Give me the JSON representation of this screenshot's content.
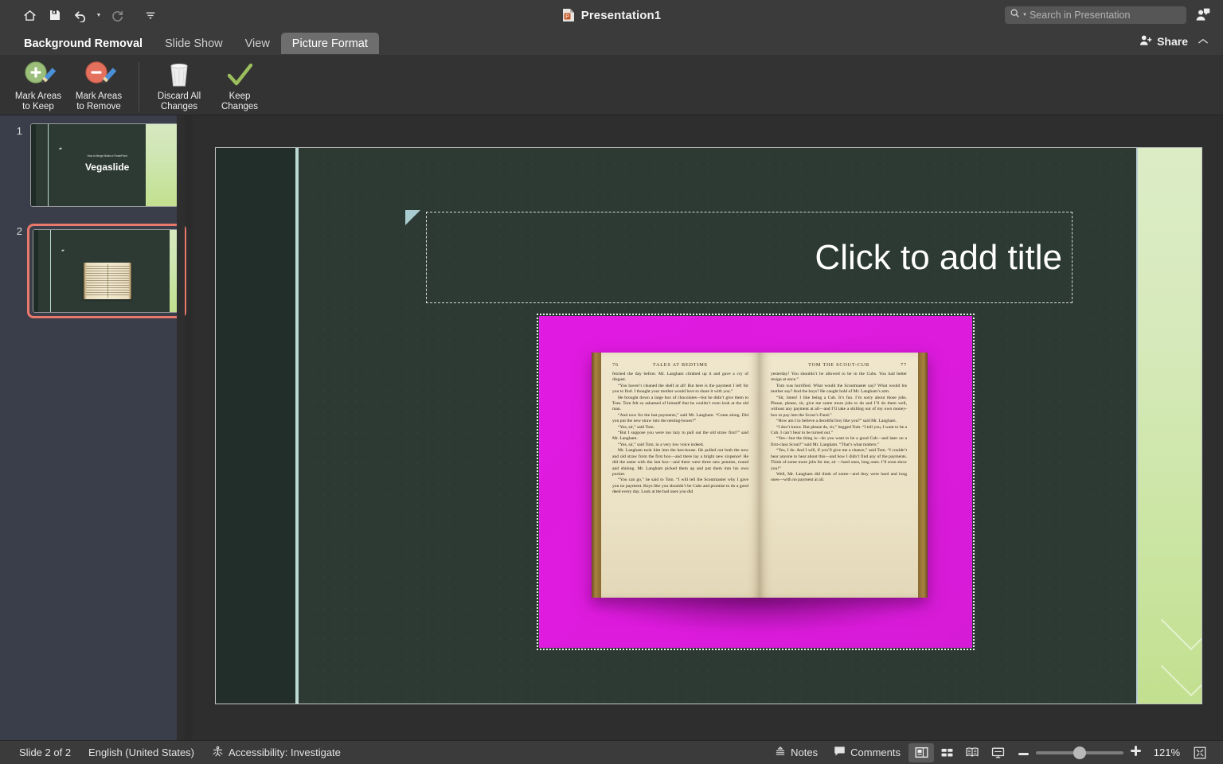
{
  "titlebar": {
    "document_title": "Presentation1",
    "doc_icon": "powerpoint-file-icon",
    "quick_access": [
      {
        "name": "home-icon",
        "label": "Home"
      },
      {
        "name": "save-icon",
        "label": "Save"
      },
      {
        "name": "undo-icon",
        "label": "Undo"
      },
      {
        "name": "redo-icon",
        "label": "Redo"
      },
      {
        "name": "customize-toolbar-icon",
        "label": "Customize Quick Access Toolbar"
      }
    ],
    "search": {
      "placeholder": "Search in Presentation",
      "value": "",
      "icon": "search-icon"
    },
    "collab_icon": "collaborators-icon"
  },
  "tabs": [
    {
      "label": "Background Removal",
      "state": "active"
    },
    {
      "label": "Slide Show",
      "state": "normal"
    },
    {
      "label": "View",
      "state": "normal"
    },
    {
      "label": "Picture Format",
      "state": "hover"
    }
  ],
  "tabbar_right": {
    "share_label": "Share",
    "share_icon": "person-add-icon",
    "collapse_icon": "chevron-up-icon"
  },
  "ribbon": {
    "items": [
      {
        "label_line1": "Mark Areas",
        "label_line2": "to Keep",
        "icon": "mark-keep-plus-icon"
      },
      {
        "label_line1": "Mark Areas",
        "label_line2": "to Remove",
        "icon": "mark-remove-minus-icon"
      },
      {
        "label_line1": "Discard All",
        "label_line2": "Changes",
        "icon": "trash-icon"
      },
      {
        "label_line1": "Keep",
        "label_line2": "Changes",
        "icon": "checkmark-icon"
      }
    ]
  },
  "slide_panel": {
    "slides": [
      {
        "number": "1",
        "selected": false,
        "subtitle": "How to Merge Slides in PowerPoint",
        "title": "Vegaslide"
      },
      {
        "number": "2",
        "selected": true,
        "subtitle": "",
        "title": ""
      }
    ]
  },
  "slide_editor": {
    "title_placeholder": "Click to add title",
    "title_deco_icon": "triangle-decoration-icon",
    "picture": {
      "name": "open-book-picture",
      "background_color": "#e020e0",
      "alt": "Open antique book on magenta background",
      "left_page": {
        "page_number": "76",
        "running_head": "TALES AT BEDTIME",
        "paragraphs": [
          "fetched the day before.  Mr. Langham climbed up it and gave a cry of disgust.",
          "“You haven’t cleaned the shelf at all!  But here is the payment I left for you to find.  I thought your mother would love to share it with you.”",
          "He brought down a large box of chocolates—but he didn’t give them to Tom.  Tom felt so ashamed of himself that he couldn’t even look at the old man.",
          "“And now for the last payments,” said Mr. Langham.  “Come along.  Did you put the new straw into the nesting-boxes?”",
          "“Yes, sir,” said Tom.",
          "“But I suppose you were too lazy to pull out the old straw first?” said Mr. Langham.",
          "“Yes, sir,” said Tom, in a very low voice indeed.",
          "Mr. Langham took him into the hen-house. He pulled out both the new and old straw from the first box—and there lay a bright new sixpence! He did the same with the last box—and there were three new pennies, round and shining. Mr. Langham picked them up and put them into his own pocket.",
          "“You can go,” he said to Tom.  “I will tell the Scoutmaster why I gave you no payment. Boys like you shouldn’t be Cubs and promise to do a good deed every day.  Look at the bad ones you did"
        ]
      },
      "right_page": {
        "page_number": "77",
        "running_head": "TOM THE SCOUT-CUB",
        "paragraphs": [
          "yesterday!  You shouldn’t be allowed to be in the Cubs.  You had better resign at once.”",
          "Tom was horrified.  What would the Scoutmaster say?  What would his mother say?  And the boys?  He caught hold of Mr. Langham’s arm.",
          "“Sir, listen!  I like being a Cub.  It’s fun.  I’m sorry about those jobs.  Please, please, sir, give me some more jobs to do and I’ll do them well, without any payment at all—and I’ll take a shilling out of my own money-box to pay into the Scout’s Fund.”",
          "“How am I to believe a deceitful boy like you?” said Mr. Langham.",
          "“I don’t know.  But please do, sir,” begged Tom. “I tell you, I want to be a Cub.  I can’t bear to be turned out.”",
          "“Yes—but the thing is—do you want to be a good Cub—and later on a first-class Scout?” said Mr. Langham.  “That’s what matters.”",
          "“Yes, I do.  And I will, if you’ll give me a chance,” said Tom.  “I couldn’t bear anyone to hear about this—and how I didn’t find any of the payments.  Think of some more jobs for me, sir —hard ones, long ones.  I’ll soon show you!”",
          "Well, Mr. Langham did think of some—and they were hard and long ones—with no payment at all."
        ]
      }
    }
  },
  "statusbar": {
    "slide_indicator": "Slide 2 of 2",
    "language": "English (United States)",
    "accessibility": "Accessibility: Investigate",
    "accessibility_icon": "accessibility-icon",
    "notes_label": "Notes",
    "notes_icon": "notes-icon",
    "comments_label": "Comments",
    "comments_icon": "comment-bubble-icon",
    "views": [
      {
        "name": "normal-view-icon",
        "active": true
      },
      {
        "name": "slide-sorter-view-icon",
        "active": false
      },
      {
        "name": "reading-view-icon",
        "active": false
      },
      {
        "name": "slideshow-view-icon",
        "active": false
      }
    ],
    "zoom_out_icon": "minus-icon",
    "zoom_in_icon": "plus-icon",
    "zoom_level": "121%",
    "fit_icon": "fit-slide-icon"
  },
  "colors": {
    "titlebar_bg": "#3b3b3b",
    "ribbon_bg": "#333333",
    "panel_bg": "#3a3d4a",
    "canvas_bg": "#2e2e2e",
    "slide_bg": "#2c3a33",
    "accent_green": "#c2e08f",
    "accent_teal": "#bcd9d4",
    "selection_red": "#e8796b",
    "magenta": "#e020e0"
  }
}
